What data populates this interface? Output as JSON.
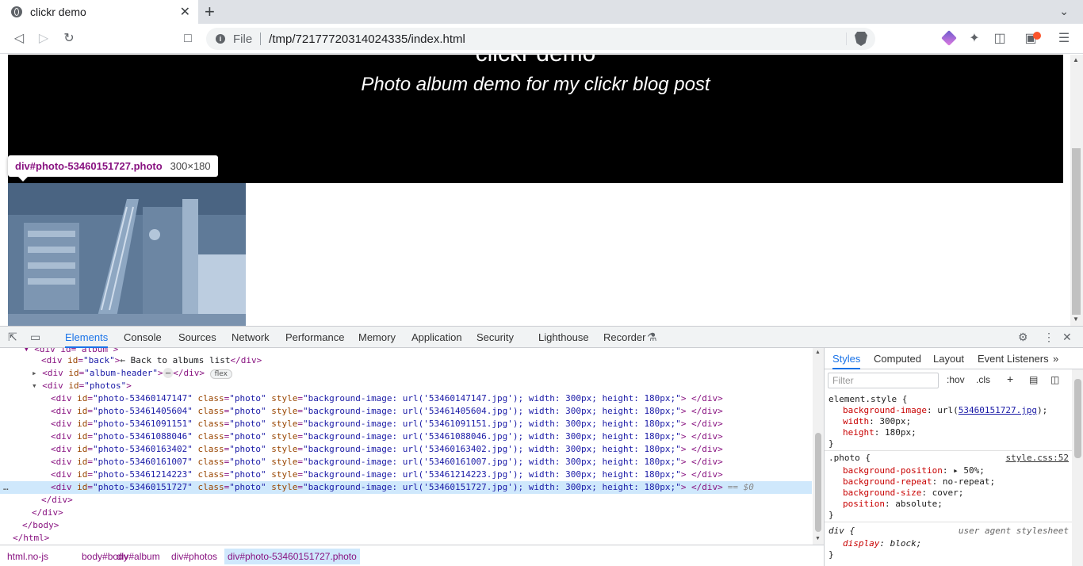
{
  "browser": {
    "tab_title": "clickr demo",
    "tab_close": "✕",
    "new_tab": "+",
    "tab_menu": "⌄",
    "url_scheme": "File",
    "url": "/tmp/72177720314024335/index.html"
  },
  "page": {
    "title": "clickr demo",
    "subtitle": "Photo album demo for my clickr blog post"
  },
  "tooltip": {
    "selector": "div#photo-53460151727.photo",
    "dimensions": "300×180"
  },
  "devtools": {
    "tabs": [
      "Elements",
      "Console",
      "Sources",
      "Network",
      "Performance",
      "Memory",
      "Application",
      "Security",
      "Lighthouse",
      "Recorder"
    ],
    "active_tab": "Elements",
    "dom": {
      "line0": "<div id=\"album\">",
      "back_div_text": "← Back to albums list",
      "album_header_id": "album-header",
      "flex_badge": "flex",
      "photos_id": "photos",
      "photo_rows": [
        {
          "id": "photo-53460147147",
          "style": "background-image: url('53460147147.jpg'); width: 300px; height: 180px;"
        },
        {
          "id": "photo-53461405604",
          "style": "background-image: url('53461405604.jpg'); width: 300px; height: 180px;"
        },
        {
          "id": "photo-53461091151",
          "style": "background-image: url('53461091151.jpg'); width: 300px; height: 180px;"
        },
        {
          "id": "photo-53461088046",
          "style": "background-image: url('53461088046.jpg'); width: 300px; height: 180px;"
        },
        {
          "id": "photo-53460163402",
          "style": "background-image: url('53460163402.jpg'); width: 300px; height: 180px;"
        },
        {
          "id": "photo-53460161007",
          "style": "background-image: url('53460161007.jpg'); width: 300px; height: 180px;"
        },
        {
          "id": "photo-53461214223",
          "style": "background-image: url('53461214223.jpg'); width: 300px; height: 180px;"
        },
        {
          "id": "photo-53460151727",
          "style": "background-image: url('53460151727.jpg'); width: 300px; height: 180px;"
        }
      ],
      "selected_marker": "== $0",
      "photo_class": "photo"
    },
    "breadcrumbs": [
      "html.no-js",
      "body#body",
      "div#album",
      "div#photos",
      "div#photo-53460151727.photo"
    ],
    "styles_tabs": [
      "Styles",
      "Computed",
      "Layout",
      "Event Listeners"
    ],
    "filter_placeholder": "Filter",
    "hov": ":hov",
    "cls": ".cls",
    "element_style": {
      "selector": "element.style {",
      "bg_prop": "background-image",
      "bg_val_prefix": "url(",
      "bg_link": "53460151727.jpg",
      "bg_val_suffix": ");",
      "width_prop": "width",
      "width_val": "300px;",
      "height_prop": "height",
      "height_val": "180px;"
    },
    "photo_rule": {
      "selector": ".photo {",
      "source": "style.css:52",
      "bp_prop": "background-position",
      "bp_val": "50%;",
      "br_prop": "background-repeat",
      "br_val": "no-repeat;",
      "bs_prop": "background-size",
      "bs_val": "cover;",
      "pos_prop": "position",
      "pos_val": "absolute;"
    },
    "ua_rule": {
      "selector": "div {",
      "source": "user agent stylesheet",
      "display_prop": "display",
      "display_val": "block;"
    }
  },
  "colors": {
    "accent": "#1a73e8",
    "tag": "#881280",
    "attr": "#994500",
    "value": "#1a1aa6"
  }
}
